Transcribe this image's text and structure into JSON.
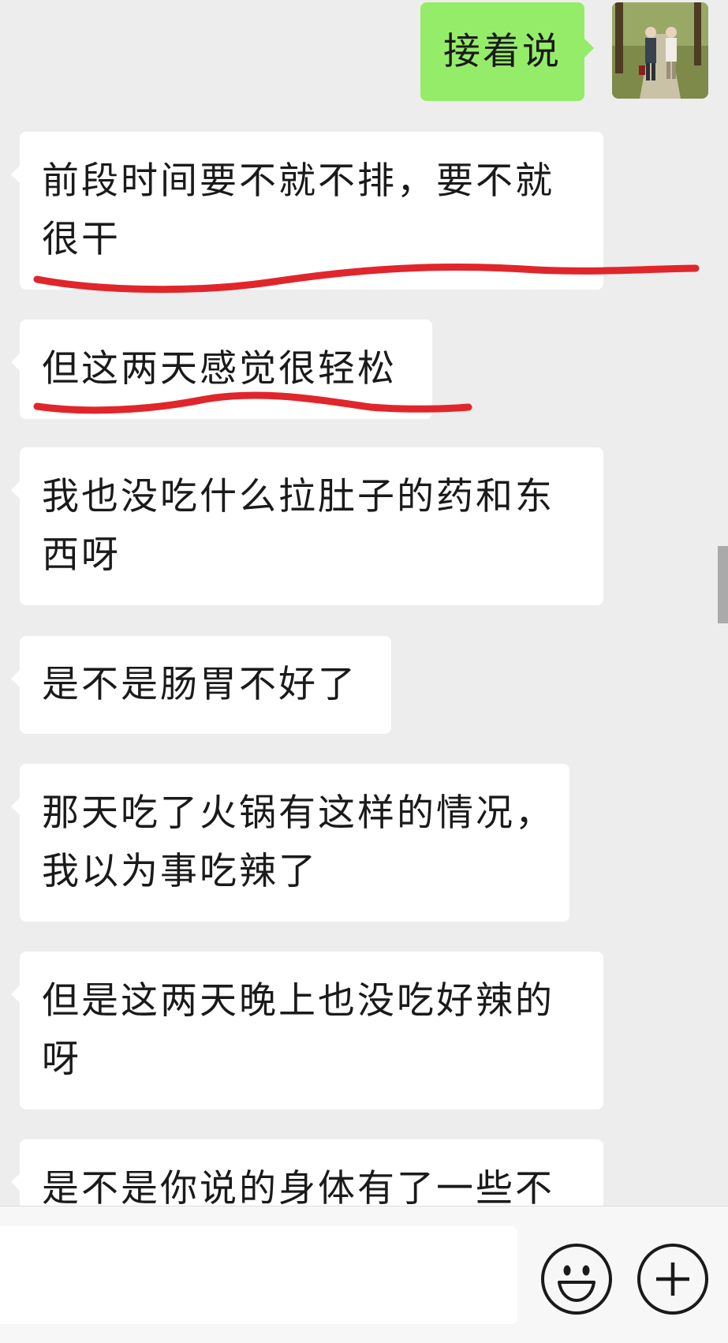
{
  "messages": [
    {
      "side": "out",
      "lines": [
        "接着说"
      ]
    },
    {
      "side": "in",
      "lines": [
        "前段时间要不就不排，要不就",
        "很干"
      ],
      "underlined": true
    },
    {
      "side": "in",
      "lines": [
        "但这两天感觉很轻松"
      ],
      "underlined": true
    },
    {
      "side": "in",
      "lines": [
        "我也没吃什么拉肚子的药和东",
        "西呀"
      ]
    },
    {
      "side": "in",
      "lines": [
        "是不是肠胃不好了"
      ]
    },
    {
      "side": "in",
      "lines": [
        "那天吃了火锅有这样的情况，",
        "我以为事吃辣了"
      ]
    },
    {
      "side": "in",
      "lines": [
        "但是这两天晚上也没吃好辣的",
        "呀"
      ]
    },
    {
      "side": "in",
      "lines": [
        "是不是你说的身体有了一些不"
      ]
    }
  ],
  "annotation_color": "#e0262b",
  "input_bar": {
    "value": "",
    "emoji_icon": "emoji-smile-icon",
    "plus_icon": "plus-circle-icon"
  }
}
